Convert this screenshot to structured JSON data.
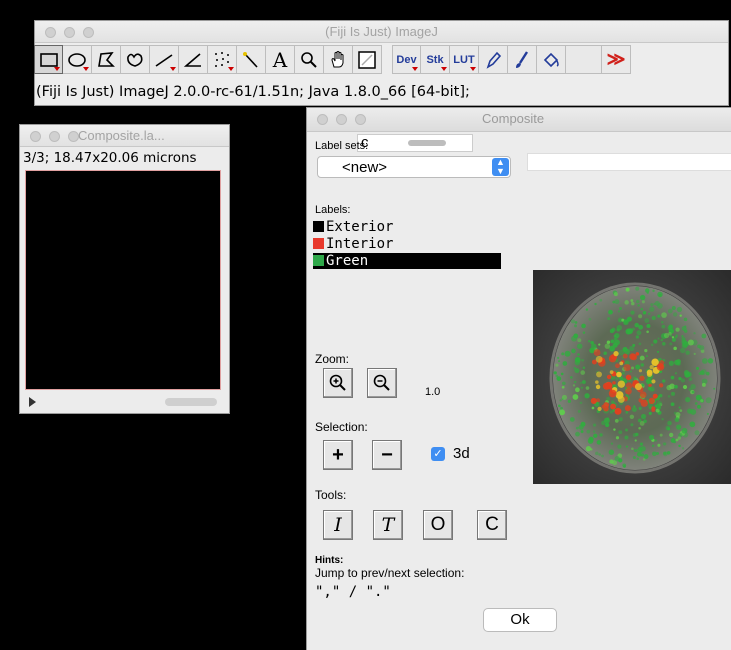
{
  "imagej": {
    "title": "(Fiji Is Just) ImageJ",
    "status": "(Fiji Is Just) ImageJ 2.0.0-rc-61/1.51n; Java 1.8.0_66 [64-bit];",
    "tools": [
      {
        "icon": "rectangle-tool-icon",
        "selected": true
      },
      {
        "icon": "oval-tool-icon"
      },
      {
        "icon": "polygon-tool-icon"
      },
      {
        "icon": "freehand-tool-icon"
      },
      {
        "icon": "line-tool-icon"
      },
      {
        "icon": "angle-tool-icon"
      },
      {
        "icon": "multipoint-tool-icon"
      },
      {
        "icon": "wand-tool-icon"
      },
      {
        "icon": "text-tool-icon",
        "label": "A"
      },
      {
        "icon": "magnifier-tool-icon"
      },
      {
        "icon": "hand-tool-icon"
      },
      {
        "icon": "color-picker-tool-icon"
      },
      {
        "icon": "dev-menu-icon",
        "label": "Dev"
      },
      {
        "icon": "stk-menu-icon",
        "label": "Stk"
      },
      {
        "icon": "lut-menu-icon",
        "label": "LUT"
      },
      {
        "icon": "pencil-tool-icon"
      },
      {
        "icon": "brush-tool-icon"
      },
      {
        "icon": "flood-fill-tool-icon"
      },
      {
        "icon": "more-tools-icon",
        "label": "≫"
      }
    ]
  },
  "composite_small": {
    "title": "Composite.la...",
    "dims": "3/3; 18.47x20.06 microns"
  },
  "composite": {
    "title": "Composite",
    "popup_letter": "c",
    "label_sets_label": "Label sets:",
    "label_set_value": "<new>",
    "labels_heading": "Labels:",
    "labels": [
      {
        "name": "Exterior",
        "color": "#000000",
        "selected": false
      },
      {
        "name": "Interior",
        "color": "#e8392c",
        "selected": false
      },
      {
        "name": "Green",
        "color": "#2fa84a",
        "selected": true
      }
    ],
    "zoom_label": "Zoom:",
    "zoom_value": "1.0",
    "selection_label": "Selection:",
    "add_label": "+",
    "remove_label": "−",
    "three_d_label": "3d",
    "three_d_checked": true,
    "tools_label": "Tools:",
    "tool_buttons": [
      "I",
      "T",
      "O",
      "C"
    ],
    "hints_label": "Hints:",
    "hint_text": "Jump to prev/next selection:",
    "hint_keys": "\",\" / \".\"",
    "ok_label": "Ok"
  },
  "colors": {
    "accent": "#3f8ef2",
    "selected_row": "#000000"
  }
}
